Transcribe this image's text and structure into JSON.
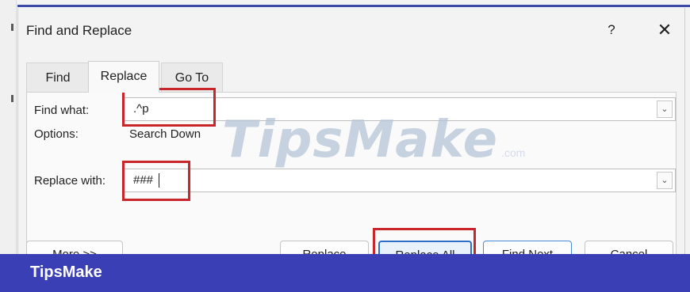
{
  "dialog": {
    "title": "Find and Replace",
    "help_label": "?",
    "close_label": "✕"
  },
  "tabs": [
    {
      "label": "Find",
      "active": false
    },
    {
      "label": "Replace",
      "active": true
    },
    {
      "label": "Go To",
      "active": false
    }
  ],
  "find": {
    "label": "Find what:",
    "value": ".^p",
    "options_label": "Options:",
    "options_value": "Search Down"
  },
  "replace": {
    "label": "Replace with:",
    "value": "###"
  },
  "buttons": {
    "more": "More >>",
    "replace": "Replace",
    "replace_all": "Replace All",
    "find_next": "Find Next",
    "cancel": "Cancel"
  },
  "icons": {
    "dropdown": "chevron-down-icon",
    "close": "close-icon",
    "help": "help-icon"
  },
  "watermark": {
    "main": "TipsMake",
    "suffix": ".com"
  },
  "banner": {
    "brand": "TipsMake"
  },
  "colors": {
    "highlight": "#c9262c",
    "banner": "#3b3fb5",
    "primary_border": "#2f6fc7"
  }
}
